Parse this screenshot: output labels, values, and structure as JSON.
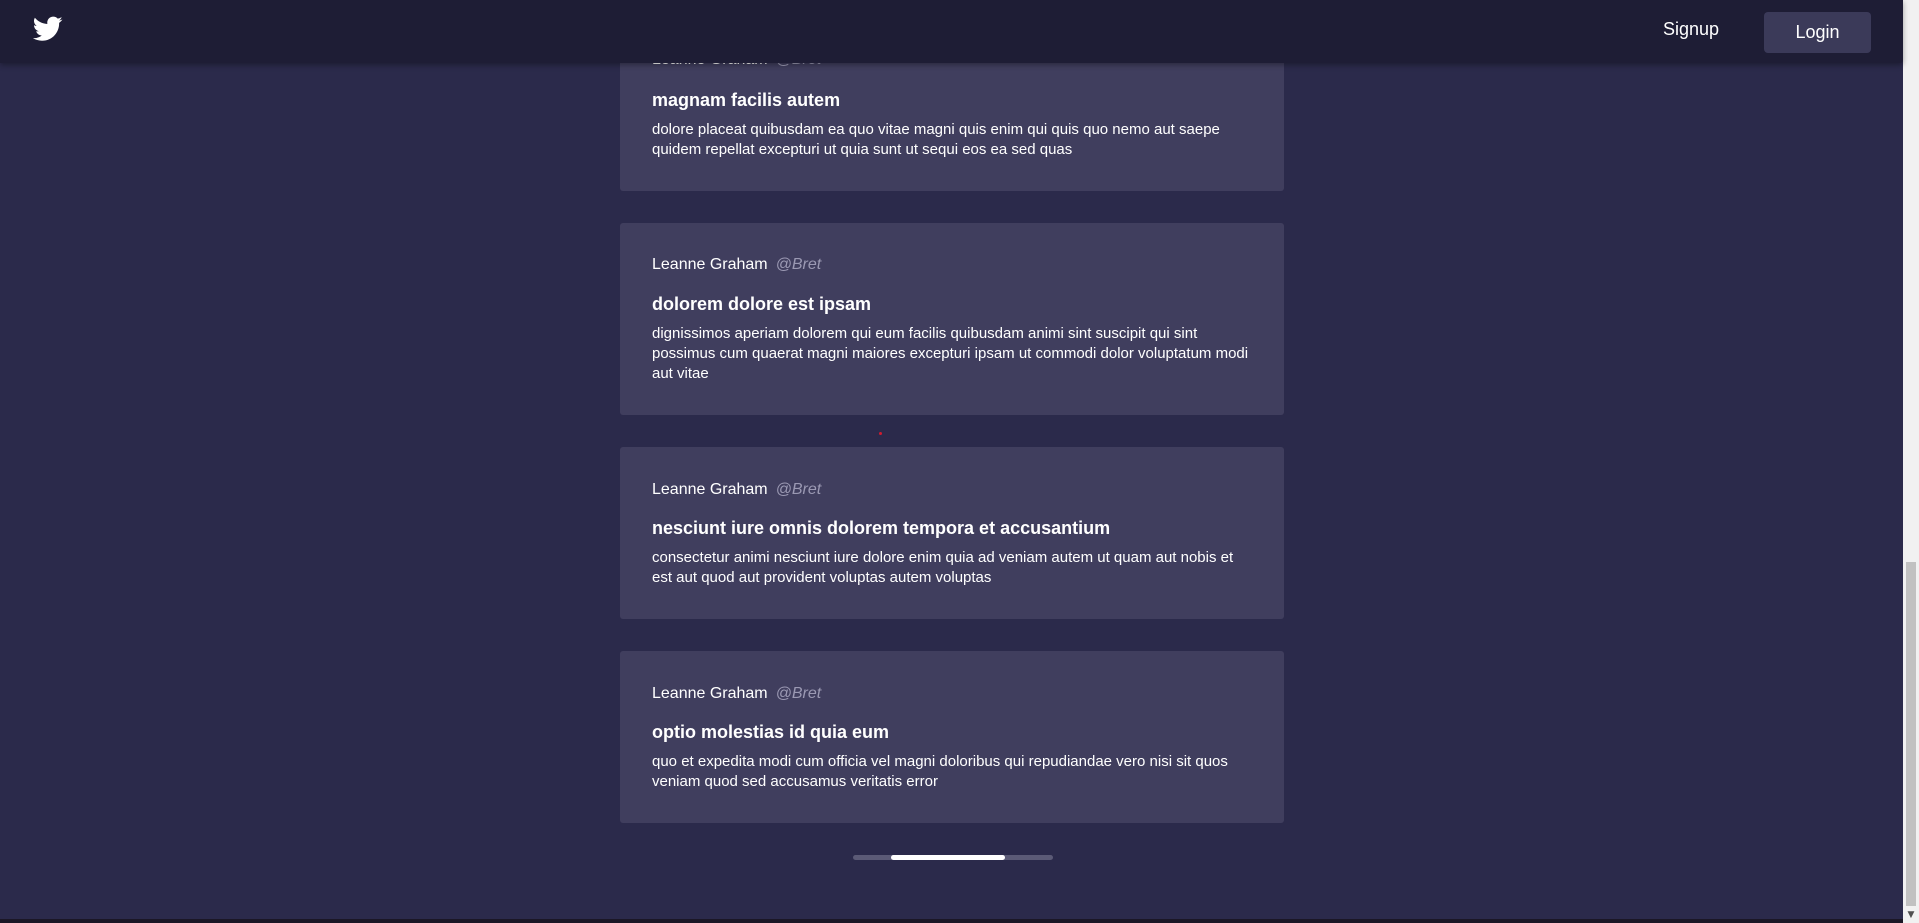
{
  "header": {
    "logo_icon": "twitter-bird-icon",
    "signup_label": "Signup",
    "login_label": "Login"
  },
  "posts": [
    {
      "author": "Leanne Graham",
      "handle": "@Bret",
      "title": "magnam facilis autem",
      "body": "dolore placeat quibusdam ea quo vitae magni quis enim qui quis quo nemo aut saepe quidem repellat excepturi ut quia sunt ut sequi eos ea sed quas"
    },
    {
      "author": "Leanne Graham",
      "handle": "@Bret",
      "title": "dolorem dolore est ipsam",
      "body": "dignissimos aperiam dolorem qui eum facilis quibusdam animi sint suscipit qui sint possimus cum quaerat magni maiores excepturi ipsam ut commodi dolor voluptatum modi aut vitae"
    },
    {
      "author": "Leanne Graham",
      "handle": "@Bret",
      "title": "nesciunt iure omnis dolorem tempora et accusantium",
      "body": "consectetur animi nesciunt iure dolore enim quia ad veniam autem ut quam aut nobis et est aut quod aut provident voluptas autem voluptas"
    },
    {
      "author": "Leanne Graham",
      "handle": "@Bret",
      "title": "optio molestias id quia eum",
      "body": "quo et expedita modi cum officia vel magni doloribus qui repudiandae vero nisi sit quos veniam quod sed accusamus veritatis error"
    }
  ],
  "loader": {
    "progress_fraction": 0.57
  },
  "colors": {
    "background": "#2b2a4b",
    "card": "#403e5e",
    "header": "#1e1d35",
    "handle": "#9b99b3"
  }
}
